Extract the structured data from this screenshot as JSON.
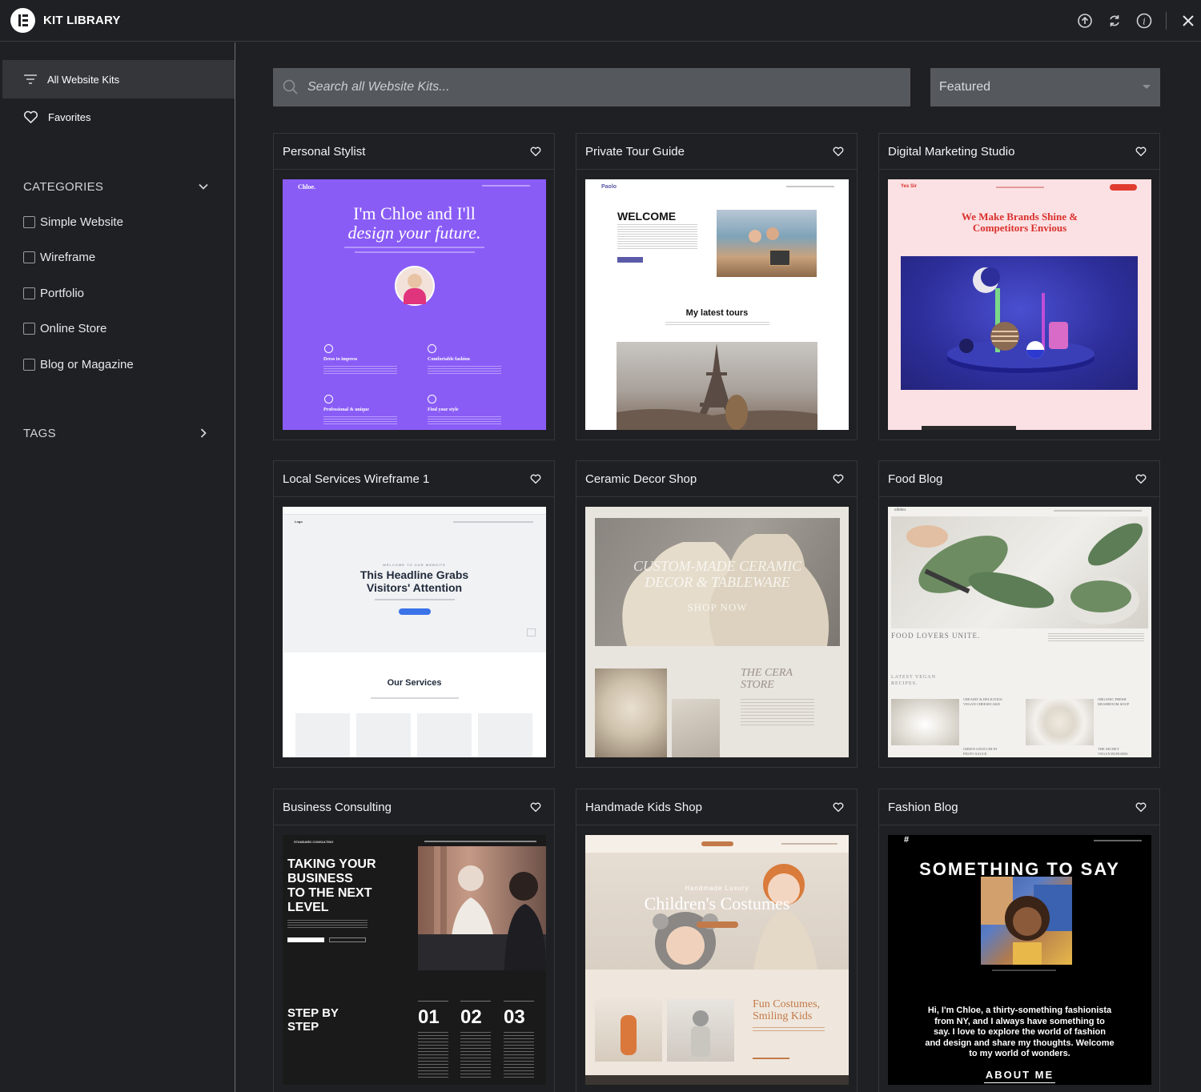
{
  "app": {
    "title": "KIT LIBRARY"
  },
  "sidebar": {
    "nav": [
      {
        "label": "All Website Kits",
        "icon": "filter-lines-icon"
      },
      {
        "label": "Favorites",
        "icon": "heart-outline-icon"
      }
    ],
    "categories_title": "CATEGORIES",
    "categories": [
      "Simple Website",
      "Wireframe",
      "Portfolio",
      "Online Store",
      "Blog or Magazine"
    ],
    "tags_title": "TAGS"
  },
  "search": {
    "placeholder": "Search all Website Kits..."
  },
  "sort": {
    "selected": "Featured"
  },
  "kits": [
    {
      "title": "Personal Stylist"
    },
    {
      "title": "Private Tour Guide"
    },
    {
      "title": "Digital Marketing Studio"
    },
    {
      "title": "Local Services Wireframe 1"
    },
    {
      "title": "Ceramic Decor Shop"
    },
    {
      "title": "Food Blog"
    },
    {
      "title": "Business Consulting"
    },
    {
      "title": "Handmade Kids Shop"
    },
    {
      "title": "Fashion Blog"
    }
  ],
  "previews": {
    "stylist": {
      "brand": "Chloe.",
      "headline1": "I'm Chloe and I'll",
      "headline2": "design your future.",
      "f1": "Dress to impress",
      "f2": "Comfortable fashion",
      "f3": "Professional & unique",
      "f4": "Find your style"
    },
    "tour": {
      "brand": "Paolo",
      "welcome": "WELCOME",
      "latest": "My latest tours"
    },
    "marketing": {
      "brand": "Yes Sir",
      "headline1": "We Make Brands Shine &",
      "headline2": "Competitors Envious"
    },
    "wireframe": {
      "brand": "Logo",
      "eyebrow": "WELCOME TO OUR WEBSITE",
      "headline1": "This Headline Grabs",
      "headline2": "Visitors' Attention",
      "services": "Our Services"
    },
    "ceramic": {
      "headline1": "CUSTOM-MADE CERAMIC",
      "headline2": "DECOR & TABLEWARE",
      "cta": "SHOP NOW",
      "store1": "THE CERA",
      "store2": "STORE"
    },
    "food": {
      "brand": "nibbles",
      "tagline": "FOOD LOVERS UNITE.",
      "latest1": "LATEST VEGAN",
      "latest2": "RECIPES.",
      "r1a": "CREAMY & DELICIOUS",
      "r1b": "VEGAN CHEESECAKE",
      "r2a": "ORGANIC FRESH",
      "r2b": "MUSHROOM SOUP",
      "r3a": "GREEN GNOCCHI IN",
      "r3b": "PESTO SAUCE",
      "r4a": "THE SECRET",
      "r4b": "VEGAN BURGERS"
    },
    "consulting": {
      "brand": "STANDARD CONSULTING",
      "headline1": "TAKING YOUR",
      "headline2": "BUSINESS",
      "headline3": "TO THE NEXT",
      "headline4": "LEVEL",
      "step1": "STEP BY",
      "step2": "STEP",
      "n1": "01",
      "n2": "02",
      "n3": "03"
    },
    "kids": {
      "eyebrow": "Handmade Luxury",
      "headline": "Children's Costumes",
      "sub1": "Fun Costumes,",
      "sub2": "Smiling Kids"
    },
    "fashion": {
      "mark": "#",
      "headline": "SOMETHING TO SAY",
      "bio1": "Hi, I'm Chloe, a thirty-something fashionista",
      "bio2": "from NY, and I always have something to",
      "bio3": "say. I love to explore the world of fashion",
      "bio4": "and design and share my thoughts. Welcome",
      "bio5": "to my world of wonders.",
      "cta": "ABOUT ME"
    }
  },
  "colors": {
    "bg": "#1f2023",
    "accent_purple": "#8a5cf6",
    "input_bg": "#55595e"
  }
}
